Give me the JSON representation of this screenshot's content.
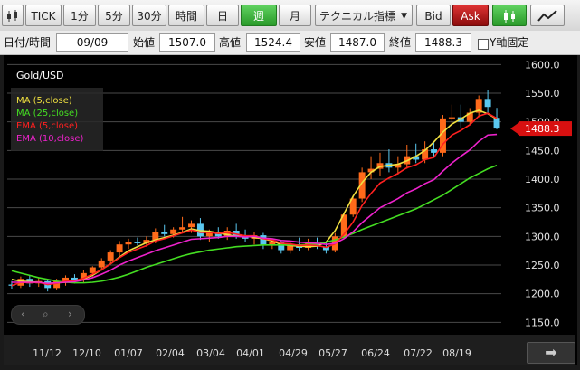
{
  "toolbar": {
    "tick_label": "TICK",
    "intervals": [
      "1分",
      "5分",
      "30分",
      "時間",
      "日",
      "週",
      "月"
    ],
    "active_interval": "週",
    "indicator_label": "テクニカル指標",
    "bid_label": "Bid",
    "ask_label": "Ask"
  },
  "info": {
    "datetime_label": "日付/時間",
    "datetime_value": "09/09",
    "open_label": "始値",
    "open_value": "1507.0",
    "high_label": "高値",
    "high_value": "1524.4",
    "low_label": "安値",
    "low_value": "1487.0",
    "close_label": "終値",
    "close_value": "1488.3",
    "yaxis_fixed_label": "Y軸固定"
  },
  "chart": {
    "pair": "Gold/USD",
    "current_price_label": "1488.3",
    "legend": [
      {
        "label": "MA (5,close)",
        "color": "#f0e040"
      },
      {
        "label": "MA (25,close)",
        "color": "#44dd22"
      },
      {
        "label": "EMA (5,close)",
        "color": "#ff2020"
      },
      {
        "label": "EMA (10,close)",
        "color": "#ee22cc"
      }
    ],
    "colors": {
      "up": "#ff6a1a",
      "down": "#5ac8f0",
      "price_marker": "#d81010"
    }
  },
  "chart_data": {
    "type": "candlestick",
    "title": "Gold/USD",
    "ylim": [
      1130,
      1610
    ],
    "y_ticks": [
      1150.0,
      1200.0,
      1250.0,
      1300.0,
      1350.0,
      1400.0,
      1450.0,
      1500.0,
      1550.0,
      1600.0
    ],
    "x_tick_labels": [
      "11/12",
      "12/10",
      "01/07",
      "02/04",
      "03/04",
      "04/01",
      "04/29",
      "05/27",
      "06/24",
      "07/22",
      "08/19"
    ],
    "current_price": 1488.3,
    "candles": [
      {
        "o": 1216,
        "h": 1222,
        "l": 1208,
        "c": 1214
      },
      {
        "o": 1214,
        "h": 1230,
        "l": 1210,
        "c": 1226
      },
      {
        "o": 1226,
        "h": 1232,
        "l": 1212,
        "c": 1218
      },
      {
        "o": 1218,
        "h": 1228,
        "l": 1212,
        "c": 1222
      },
      {
        "o": 1222,
        "h": 1226,
        "l": 1204,
        "c": 1210
      },
      {
        "o": 1210,
        "h": 1226,
        "l": 1206,
        "c": 1222
      },
      {
        "o": 1222,
        "h": 1232,
        "l": 1214,
        "c": 1228
      },
      {
        "o": 1228,
        "h": 1234,
        "l": 1218,
        "c": 1224
      },
      {
        "o": 1224,
        "h": 1242,
        "l": 1220,
        "c": 1236
      },
      {
        "o": 1236,
        "h": 1248,
        "l": 1230,
        "c": 1246
      },
      {
        "o": 1246,
        "h": 1262,
        "l": 1240,
        "c": 1258
      },
      {
        "o": 1258,
        "h": 1276,
        "l": 1252,
        "c": 1272
      },
      {
        "o": 1272,
        "h": 1292,
        "l": 1266,
        "c": 1286
      },
      {
        "o": 1286,
        "h": 1296,
        "l": 1278,
        "c": 1290
      },
      {
        "o": 1290,
        "h": 1298,
        "l": 1284,
        "c": 1288
      },
      {
        "o": 1288,
        "h": 1300,
        "l": 1282,
        "c": 1294
      },
      {
        "o": 1294,
        "h": 1314,
        "l": 1288,
        "c": 1308
      },
      {
        "o": 1308,
        "h": 1320,
        "l": 1300,
        "c": 1304
      },
      {
        "o": 1304,
        "h": 1316,
        "l": 1298,
        "c": 1312
      },
      {
        "o": 1312,
        "h": 1334,
        "l": 1308,
        "c": 1316
      },
      {
        "o": 1316,
        "h": 1328,
        "l": 1306,
        "c": 1322
      },
      {
        "o": 1322,
        "h": 1332,
        "l": 1294,
        "c": 1300
      },
      {
        "o": 1300,
        "h": 1312,
        "l": 1290,
        "c": 1306
      },
      {
        "o": 1306,
        "h": 1316,
        "l": 1296,
        "c": 1300
      },
      {
        "o": 1300,
        "h": 1316,
        "l": 1294,
        "c": 1310
      },
      {
        "o": 1310,
        "h": 1322,
        "l": 1296,
        "c": 1300
      },
      {
        "o": 1300,
        "h": 1312,
        "l": 1290,
        "c": 1296
      },
      {
        "o": 1296,
        "h": 1308,
        "l": 1286,
        "c": 1302
      },
      {
        "o": 1302,
        "h": 1306,
        "l": 1278,
        "c": 1284
      },
      {
        "o": 1284,
        "h": 1296,
        "l": 1278,
        "c": 1290
      },
      {
        "o": 1290,
        "h": 1294,
        "l": 1270,
        "c": 1276
      },
      {
        "o": 1276,
        "h": 1290,
        "l": 1270,
        "c": 1284
      },
      {
        "o": 1284,
        "h": 1298,
        "l": 1274,
        "c": 1280
      },
      {
        "o": 1280,
        "h": 1296,
        "l": 1276,
        "c": 1288
      },
      {
        "o": 1288,
        "h": 1298,
        "l": 1278,
        "c": 1282
      },
      {
        "o": 1282,
        "h": 1290,
        "l": 1270,
        "c": 1276
      },
      {
        "o": 1276,
        "h": 1306,
        "l": 1272,
        "c": 1300
      },
      {
        "o": 1300,
        "h": 1342,
        "l": 1296,
        "c": 1338
      },
      {
        "o": 1338,
        "h": 1370,
        "l": 1334,
        "c": 1366
      },
      {
        "o": 1366,
        "h": 1420,
        "l": 1360,
        "c": 1412
      },
      {
        "o": 1412,
        "h": 1440,
        "l": 1400,
        "c": 1418
      },
      {
        "o": 1418,
        "h": 1446,
        "l": 1406,
        "c": 1428
      },
      {
        "o": 1428,
        "h": 1452,
        "l": 1412,
        "c": 1420
      },
      {
        "o": 1420,
        "h": 1440,
        "l": 1408,
        "c": 1426
      },
      {
        "o": 1426,
        "h": 1460,
        "l": 1418,
        "c": 1440
      },
      {
        "o": 1440,
        "h": 1462,
        "l": 1428,
        "c": 1434
      },
      {
        "o": 1434,
        "h": 1466,
        "l": 1428,
        "c": 1452
      },
      {
        "o": 1452,
        "h": 1466,
        "l": 1438,
        "c": 1446
      },
      {
        "o": 1446,
        "h": 1512,
        "l": 1440,
        "c": 1506
      },
      {
        "o": 1506,
        "h": 1530,
        "l": 1496,
        "c": 1508
      },
      {
        "o": 1508,
        "h": 1530,
        "l": 1490,
        "c": 1500
      },
      {
        "o": 1500,
        "h": 1524,
        "l": 1494,
        "c": 1516
      },
      {
        "o": 1516,
        "h": 1546,
        "l": 1508,
        "c": 1540
      },
      {
        "o": 1540,
        "h": 1556,
        "l": 1514,
        "c": 1526
      },
      {
        "o": 1507,
        "h": 1524.4,
        "l": 1487,
        "c": 1488.3
      }
    ],
    "series": [
      {
        "name": "MA (5,close)",
        "color": "#f0e040",
        "values": [
          1225,
          1222,
          1221,
          1220,
          1218,
          1219,
          1220,
          1222,
          1226,
          1232,
          1242,
          1252,
          1264,
          1275,
          1282,
          1289,
          1294,
          1298,
          1302,
          1307,
          1313,
          1310,
          1309,
          1306,
          1303,
          1300,
          1301,
          1298,
          1296,
          1292,
          1286,
          1284,
          1283,
          1282,
          1283,
          1290,
          1310,
          1340,
          1370,
          1394,
          1412,
          1422,
          1424,
          1426,
          1432,
          1440,
          1450,
          1465,
          1482,
          1496,
          1505,
          1515,
          1520,
          1514,
          1505
        ]
      },
      {
        "name": "MA (25,close)",
        "color": "#44dd22",
        "values": [
          1240,
          1236,
          1232,
          1228,
          1225,
          1222,
          1220,
          1219,
          1219,
          1220,
          1222,
          1225,
          1229,
          1234,
          1240,
          1246,
          1251,
          1256,
          1261,
          1266,
          1270,
          1273,
          1276,
          1278,
          1280,
          1282,
          1283,
          1284,
          1285,
          1285,
          1285,
          1285,
          1285,
          1286,
          1287,
          1290,
          1294,
          1299,
          1305,
          1312,
          1318,
          1324,
          1330,
          1336,
          1342,
          1348,
          1356,
          1364,
          1372,
          1382,
          1392,
          1402,
          1410,
          1418,
          1424
        ]
      },
      {
        "name": "EMA (5,close)",
        "color": "#ff2020",
        "values": [
          1214,
          1220,
          1219,
          1220,
          1216,
          1218,
          1222,
          1223,
          1227,
          1234,
          1242,
          1252,
          1263,
          1272,
          1278,
          1284,
          1292,
          1296,
          1301,
          1306,
          1311,
          1307,
          1307,
          1305,
          1307,
          1304,
          1301,
          1301,
          1296,
          1294,
          1288,
          1287,
          1284,
          1285,
          1284,
          1281,
          1287,
          1304,
          1325,
          1354,
          1375,
          1393,
          1402,
          1410,
          1420,
          1425,
          1434,
          1438,
          1461,
          1477,
          1485,
          1495,
          1510,
          1515,
          1506
        ]
      },
      {
        "name": "EMA (10,close)",
        "color": "#ee22cc",
        "values": [
          1220,
          1220,
          1220,
          1220,
          1218,
          1219,
          1220,
          1221,
          1224,
          1228,
          1234,
          1241,
          1250,
          1257,
          1263,
          1269,
          1275,
          1280,
          1285,
          1290,
          1295,
          1296,
          1297,
          1298,
          1300,
          1300,
          1299,
          1300,
          1297,
          1296,
          1293,
          1292,
          1290,
          1289,
          1288,
          1286,
          1288,
          1296,
          1308,
          1324,
          1337,
          1350,
          1358,
          1366,
          1376,
          1383,
          1392,
          1399,
          1414,
          1428,
          1440,
          1451,
          1466,
          1477,
          1478
        ]
      }
    ]
  }
}
